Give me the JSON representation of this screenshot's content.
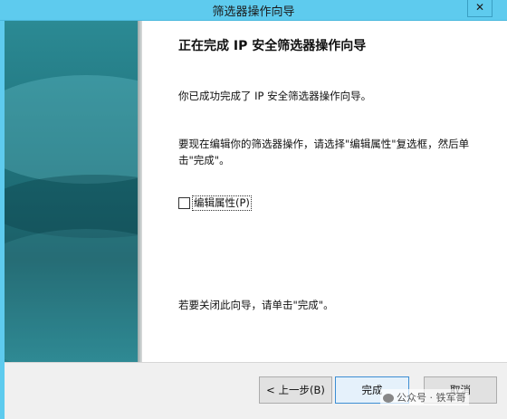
{
  "window": {
    "title": "筛选器操作向导",
    "close_glyph": "✕"
  },
  "content": {
    "heading": "正在完成 IP 安全筛选器操作向导",
    "paragraph1": "你已成功完成了 IP 安全筛选器操作向导。",
    "paragraph2": "要现在编辑你的筛选器操作，请选择\"编辑属性\"复选框，然后单击\"完成\"。",
    "checkbox_label": "编辑属性(P)",
    "checkbox_checked": false,
    "paragraph3": "若要关闭此向导，请单击\"完成\"。"
  },
  "buttons": {
    "back": "< 上一步(B)",
    "finish": "完成",
    "cancel": "取消"
  },
  "watermark": {
    "text": "公众号 · 铁军哥",
    "icon": "wechat-icon"
  }
}
